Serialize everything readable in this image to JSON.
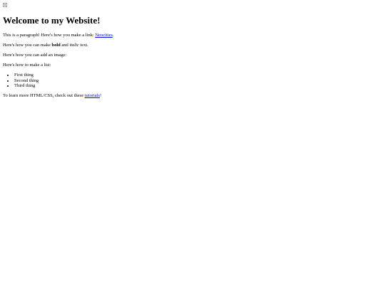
{
  "page": {
    "title": "Welcome to my Website!",
    "paragraph": {
      "before": "This is a paragraph! Here's how you make a link: ",
      "link": "Neocities",
      "after": "."
    },
    "formatting": {
      "before": "Here's how you can make ",
      "bold": "bold",
      "middle": " and ",
      "italic": "italic",
      "after": " text."
    },
    "image_text": "Here's how you can add an image:",
    "list_intro": "Here's how to make a list:",
    "list_items": [
      "First thing",
      "Second thing",
      "Third thing"
    ],
    "footer": {
      "before": "To learn more HTML/CSS, check out these ",
      "link": "tutorials",
      "after": "!"
    }
  }
}
